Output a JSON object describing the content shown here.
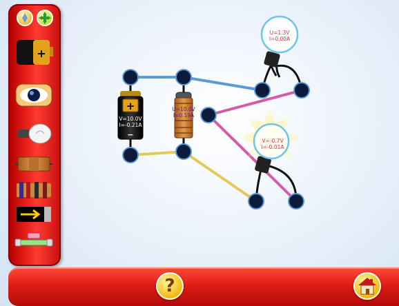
{
  "palette": {
    "top_buttons": [
      {
        "name": "options-button",
        "icon": "gear-icon"
      },
      {
        "name": "move-button",
        "icon": "move-arrows-icon"
      }
    ],
    "items": [
      {
        "name": "palette-battery",
        "icon": "battery-icon"
      },
      {
        "name": "palette-resistor",
        "icon": "resistor-icon"
      },
      {
        "name": "palette-bulb",
        "icon": "lightbulb-icon"
      },
      {
        "name": "palette-wire",
        "icon": "wire-icon"
      },
      {
        "name": "palette-resistors",
        "icon": "resistors-icon"
      },
      {
        "name": "palette-switch",
        "icon": "switch-icon"
      },
      {
        "name": "palette-fuse",
        "icon": "fuse-icon"
      }
    ]
  },
  "circuit": {
    "battery": {
      "plus": "+",
      "minus": "−",
      "voltage": "V=10.0V",
      "current": "I=-0.21A"
    },
    "resistor": {
      "voltage": "U=10.0V",
      "current": "I=0.19A"
    },
    "bulb_top": {
      "voltage": "U=1.3V",
      "current": "I=0.00A"
    },
    "bulb_bottom": {
      "voltage": "V=-0.7V",
      "current": "I=-0.01A"
    }
  },
  "bottom_bar": {
    "help_label": "?",
    "help_icon": "question-icon",
    "home_icon": "home-icon"
  },
  "colors": {
    "frame_red": "#e8211b",
    "wire_blue": "#5b9bd5",
    "wire_pink": "#d65aa8",
    "wire_yellow": "#e3c95a",
    "node": "#0d1a3a"
  }
}
